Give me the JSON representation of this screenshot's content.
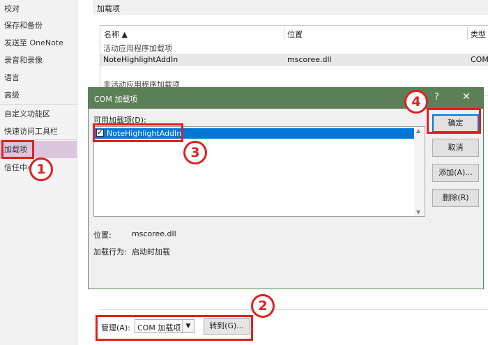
{
  "sidebar": {
    "items": [
      "校对",
      "保存和备份",
      "发送至 OneNote",
      "录音和录像",
      "语言",
      "高级",
      "自定义功能区",
      "快速访问工具栏",
      "加载项",
      "信任中心"
    ]
  },
  "main": {
    "section_title": "加载项",
    "table": {
      "headers": [
        "名称 ▲",
        "位置",
        "类型"
      ],
      "group_active": "活动应用程序加载项",
      "row": {
        "name": "NoteHighlightAddIn",
        "location": "mscoree.dll",
        "type": "COM"
      },
      "group_inactive": "非活动应用程序加载项"
    },
    "manage": {
      "label": "管理(A):",
      "value": "COM 加载项",
      "go_button": "转到(G)..."
    }
  },
  "dialog": {
    "title": "COM 加载项",
    "help_icon": "?",
    "close_icon": "✕",
    "available_label": "可用加载项(D):",
    "addin": {
      "name": "NoteHighlightAddIn",
      "checked": true
    },
    "buttons": {
      "ok": "确定",
      "cancel": "取消",
      "add": "添加(A)...",
      "remove": "删除(R)"
    },
    "location_label": "位置:",
    "location_value": "mscoree.dll",
    "behavior_label": "加载行为:",
    "behavior_value": "启动时加载"
  },
  "annotations": {
    "step1": "1",
    "step2": "2",
    "step3": "3",
    "step4": "4",
    "color": "#e02020"
  }
}
